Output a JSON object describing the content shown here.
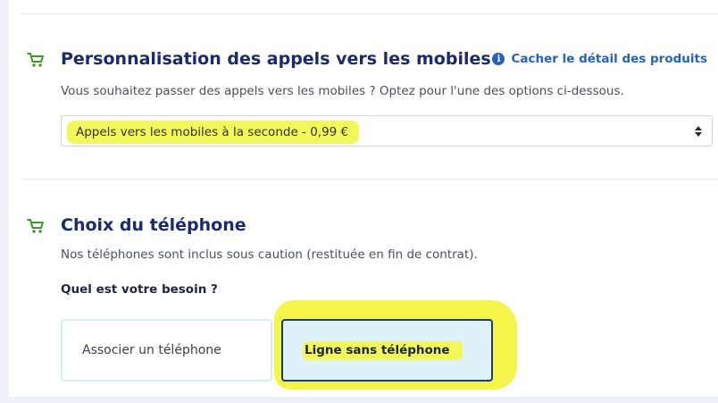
{
  "mobile_calls": {
    "title": "Personnalisation des appels vers les mobiles",
    "description": "Vous souhaitez passer des appels vers les mobiles ? Optez pour l'une des options ci-dessous.",
    "detail_link": "Cacher le détail des produits",
    "select_value": "Appels vers les mobiles à la seconde - 0,99 €"
  },
  "phone_choice": {
    "title": "Choix du téléphone",
    "description": "Nos téléphones sont inclus sous caution (restituée en fin de contrat).",
    "question": "Quel est votre besoin ?",
    "options": [
      {
        "label": "Associer un téléphone",
        "selected": false
      },
      {
        "label": "Ligne sans téléphone",
        "selected": true
      }
    ]
  },
  "colors": {
    "title": "#1b2a6b",
    "link": "#2563b8",
    "cart_icon": "#3c9a2a",
    "highlight": "#f2f75a",
    "selected_border": "#1b3a7a",
    "selected_bg": "#dff2f8"
  },
  "icons": [
    "cart-icon",
    "info-icon",
    "select-arrows-icon"
  ]
}
